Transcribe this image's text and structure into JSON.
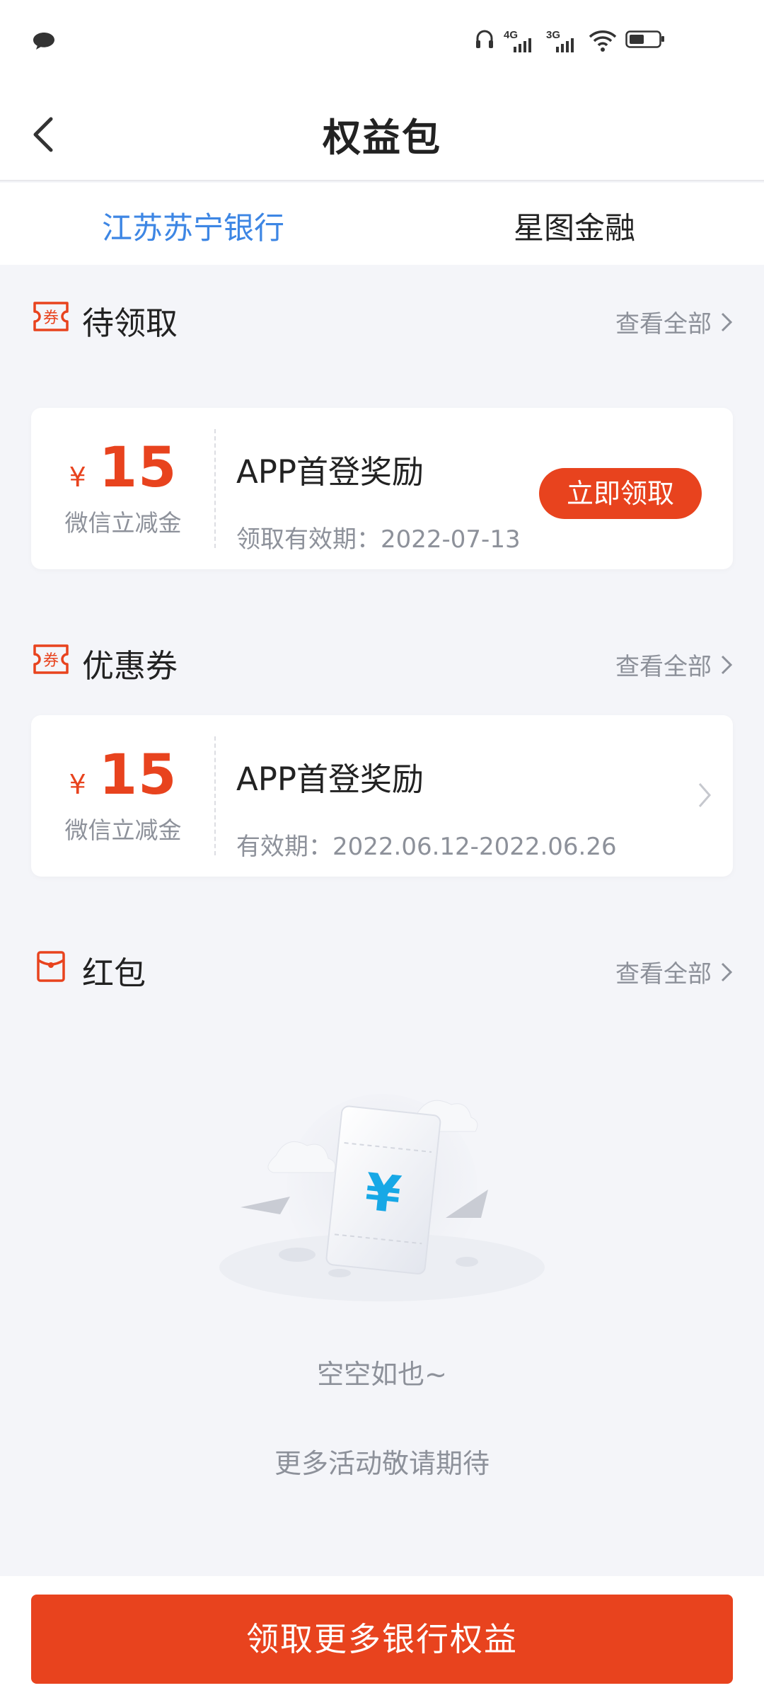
{
  "status_bar": {
    "signal_4g_label": "4G",
    "signal_3g_label": "3G"
  },
  "navbar": {
    "title": "权益包"
  },
  "tabs": [
    {
      "label": "江苏苏宁银行",
      "active": true
    },
    {
      "label": "星图金融",
      "active": false
    }
  ],
  "sections": {
    "pending": {
      "title": "待领取",
      "more": "查看全部",
      "icon_char": "券",
      "card": {
        "currency": "¥",
        "amount": "15",
        "amount_label": "微信立减金",
        "title": "APP首登奖励",
        "validity": "领取有效期：2022-07-13",
        "button": "立即领取"
      }
    },
    "coupons": {
      "title": "优惠券",
      "more": "查看全部",
      "icon_char": "券",
      "card": {
        "currency": "¥",
        "amount": "15",
        "amount_label": "微信立减金",
        "title": "APP首登奖励",
        "validity": "有效期：2022.06.12-2022.06.26"
      }
    },
    "red_packets": {
      "title": "红包",
      "more": "查看全部",
      "empty_title": "空空如也~",
      "empty_sub": "更多活动敬请期待",
      "illustration_symbol": "¥"
    }
  },
  "bottom": {
    "cta": "领取更多银行权益"
  },
  "colors": {
    "accent": "#e8431e",
    "tab_active": "#3d86e4",
    "muted_text": "#8d919a",
    "page_bg": "#f4f5f9"
  }
}
